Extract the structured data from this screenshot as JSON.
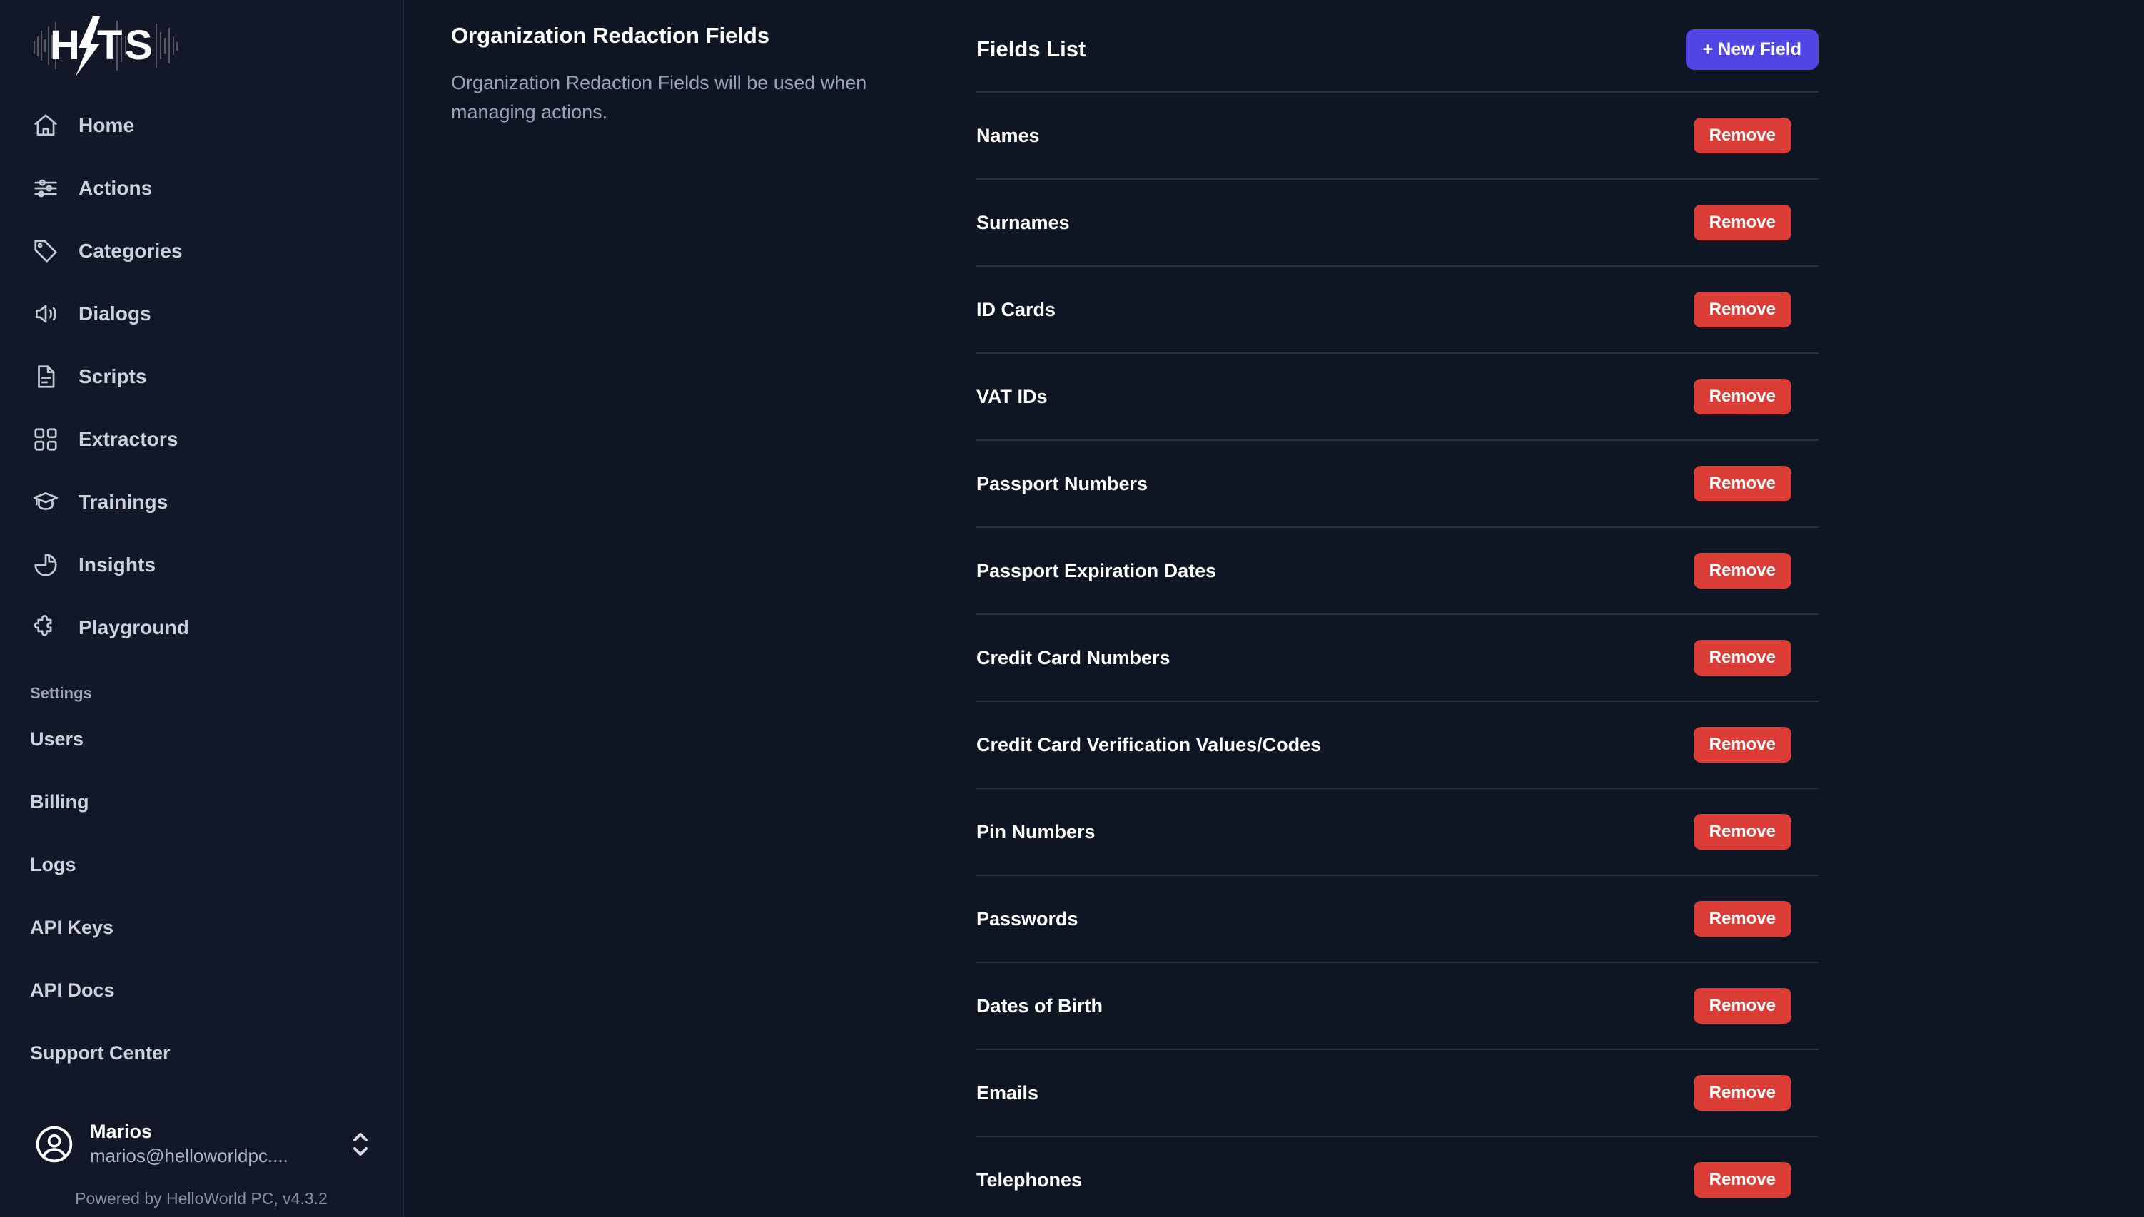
{
  "brand": {
    "logo_text": "HITS",
    "logo_icon": "lightning-bolt-waveform-logo"
  },
  "sidebar": {
    "nav_items": [
      {
        "label": "Home",
        "icon": "home-icon"
      },
      {
        "label": "Actions",
        "icon": "sliders-icon"
      },
      {
        "label": "Categories",
        "icon": "tag-icon"
      },
      {
        "label": "Dialogs",
        "icon": "speaker-icon"
      },
      {
        "label": "Scripts",
        "icon": "document-icon"
      },
      {
        "label": "Extractors",
        "icon": "grid-squares-icon"
      },
      {
        "label": "Trainings",
        "icon": "graduation-cap-icon"
      },
      {
        "label": "Insights",
        "icon": "pie-chart-icon"
      },
      {
        "label": "Playground",
        "icon": "puzzle-piece-icon"
      }
    ],
    "settings_section_label": "Settings",
    "settings_items": [
      {
        "label": "Users"
      },
      {
        "label": "Billing"
      },
      {
        "label": "Logs"
      },
      {
        "label": "API Keys"
      },
      {
        "label": "API Docs"
      },
      {
        "label": "Support Center"
      }
    ],
    "user": {
      "name": "Marios",
      "email": "marios@helloworldpc....",
      "avatar_icon": "user-circle-icon",
      "switcher_icon": "chevron-up-down-icon"
    },
    "footer": "Powered by HelloWorld PC, v4.3.2"
  },
  "info": {
    "title": "Organization Redaction Fields",
    "description": "Organization Redaction Fields will be used when managing actions."
  },
  "fields_panel": {
    "title": "Fields List",
    "new_field_button": "+ New Field",
    "remove_button": "Remove",
    "fields": [
      {
        "label": "Names"
      },
      {
        "label": "Surnames"
      },
      {
        "label": "ID Cards"
      },
      {
        "label": "VAT IDs"
      },
      {
        "label": "Passport Numbers"
      },
      {
        "label": "Passport Expiration Dates"
      },
      {
        "label": "Credit Card Numbers"
      },
      {
        "label": "Credit Card Verification Values/Codes"
      },
      {
        "label": "Pin Numbers"
      },
      {
        "label": "Passwords"
      },
      {
        "label": "Dates of Birth"
      },
      {
        "label": "Emails"
      },
      {
        "label": "Telephones"
      }
    ]
  },
  "colors": {
    "page_background": "#0f1623",
    "sidebar_background": "#121828",
    "accent_primary": "#5046e4",
    "danger": "#dc3c36",
    "text_primary": "#ffffff",
    "text_muted": "#9aa3b4",
    "divider": "#2a3142"
  }
}
